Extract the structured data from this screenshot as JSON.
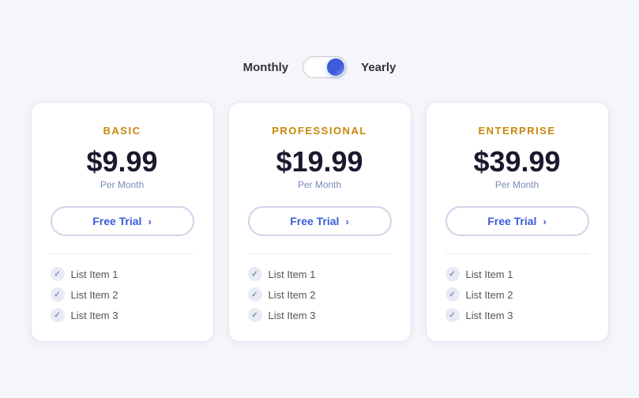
{
  "toggle": {
    "monthly_label": "Monthly",
    "yearly_label": "Yearly",
    "state": "yearly"
  },
  "plans": [
    {
      "id": "basic",
      "name": "BASIC",
      "price": "$9.99",
      "per_month": "Per Month",
      "cta": "Free Trial",
      "features": [
        "List Item 1",
        "List Item 2",
        "List Item 3"
      ]
    },
    {
      "id": "professional",
      "name": "PROFESSIONAL",
      "price": "$19.99",
      "per_month": "Per Month",
      "cta": "Free Trial",
      "features": [
        "List Item 1",
        "List Item 2",
        "List Item 3"
      ]
    },
    {
      "id": "enterprise",
      "name": "ENTERPRISE",
      "price": "$39.99",
      "per_month": "Per Month",
      "cta": "Free Trial",
      "features": [
        "List Item 1",
        "List Item 2",
        "List Item 3"
      ]
    }
  ]
}
